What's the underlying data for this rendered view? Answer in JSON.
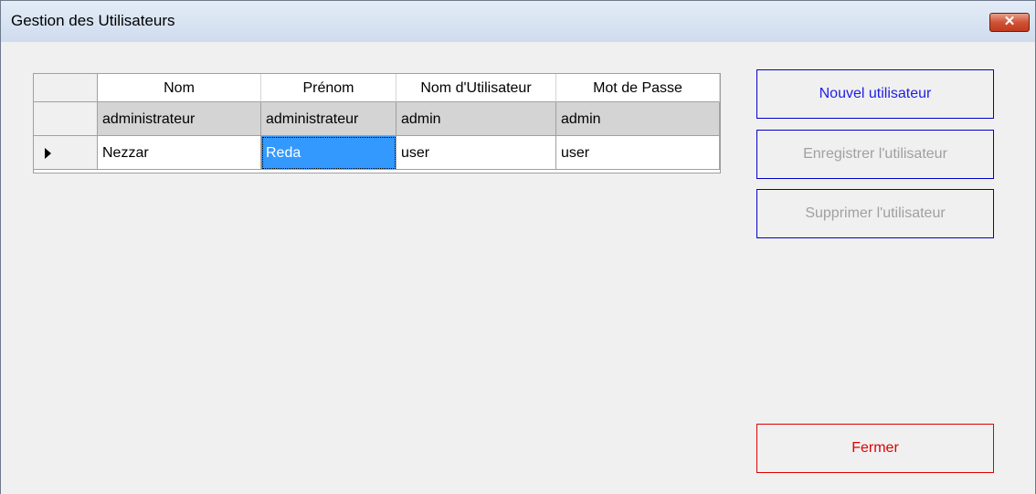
{
  "window": {
    "title": "Gestion des Utilisateurs",
    "close_glyph": "✕"
  },
  "grid": {
    "columns": [
      "Nom",
      "Prénom",
      "Nom d'Utilisateur",
      "Mot de Passe"
    ],
    "rows": [
      {
        "cells": [
          "administrateur",
          "administrateur",
          "admin",
          "admin"
        ],
        "current": false
      },
      {
        "cells": [
          "Nezzar",
          "Reda",
          "user",
          "user"
        ],
        "current": true,
        "selected_col": 1
      }
    ]
  },
  "buttons": {
    "new_user": "Nouvel utilisateur",
    "save_user": "Enregistrer l'utilisateur",
    "delete_user": "Supprimer l'utilisateur",
    "close": "Fermer"
  },
  "colors": {
    "selection": "#3399ff",
    "button_border": "#0000cc",
    "close_button": "#e00000"
  }
}
